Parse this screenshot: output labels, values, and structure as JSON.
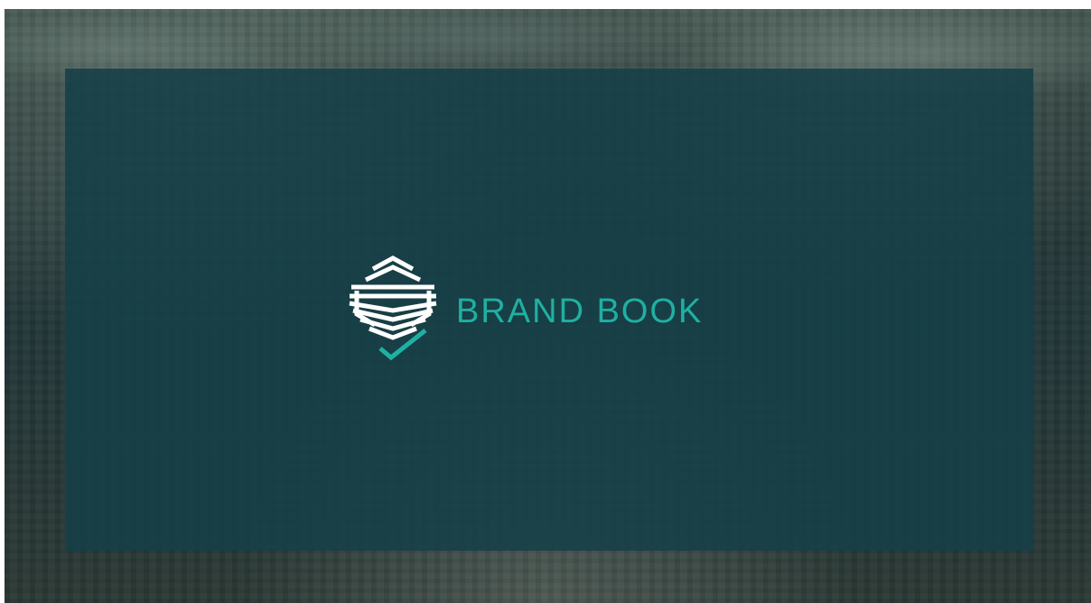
{
  "brand": {
    "title": "BRAND BOOK",
    "logo_icon": "building-check-logo-icon"
  },
  "colors": {
    "accent": "#1fb0a2",
    "overlay": "#164048",
    "logo_lines": "#ffffff"
  }
}
